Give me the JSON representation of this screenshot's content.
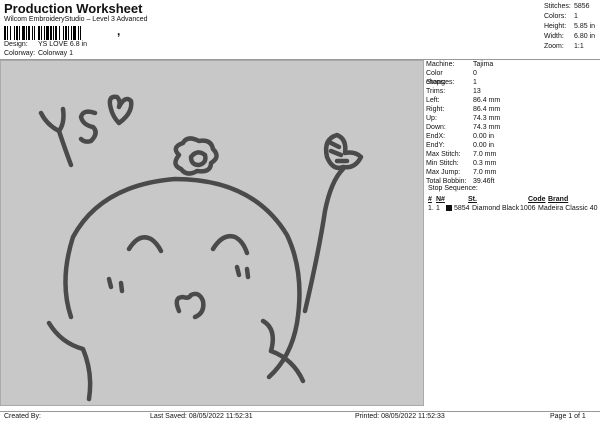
{
  "header": {
    "title": "Production Worksheet",
    "subtitle": "Wilcom EmbroideryStudio – Level 3 Advanced"
  },
  "design_info": [
    {
      "label": "Design:",
      "value": "YS LOVE 6.8 in"
    },
    {
      "label": "Colorway:",
      "value": "Colorway 1"
    }
  ],
  "stats": [
    {
      "label": "Stitches:",
      "value": "5856"
    },
    {
      "label": "Colors:",
      "value": "1"
    },
    {
      "label": "Height:",
      "value": "5.85 in"
    },
    {
      "label": "Width:",
      "value": "6.80 in"
    },
    {
      "label": "Zoom:",
      "value": "1:1"
    }
  ],
  "machine_info": [
    {
      "label": "Machine:",
      "value": "Tajima"
    },
    {
      "label": "Color changes:",
      "value": "0"
    },
    {
      "label": "Stops:",
      "value": "1"
    },
    {
      "label": "Trims:",
      "value": "13"
    },
    {
      "label": "Left:",
      "value": "86.4 mm"
    },
    {
      "label": "Right:",
      "value": "86.4 mm"
    },
    {
      "label": "Up:",
      "value": "74.3 mm"
    },
    {
      "label": "Down:",
      "value": "74.3 mm"
    },
    {
      "label": "EndX:",
      "value": "0.00 in"
    },
    {
      "label": "EndY:",
      "value": "0.00 in"
    },
    {
      "label": "Max Stitch:",
      "value": "7.0 mm"
    },
    {
      "label": "Min Stitch:",
      "value": "0.3 mm"
    },
    {
      "label": "Max Jump:",
      "value": "7.0 mm"
    },
    {
      "label": "Total Bobbin:",
      "value": "39.46ft"
    }
  ],
  "stop_sequence": {
    "title": "Stop Sequence:",
    "headers": [
      "#",
      "N#",
      "St.",
      "Code",
      "Brand"
    ],
    "rows": [
      {
        "num": "1.",
        "n": "1",
        "stitches": "5854",
        "color_name": "Diamond Black",
        "code": "1006",
        "brand": "Madeira Classic 40",
        "swatch": "#111111"
      }
    ]
  },
  "footer": {
    "created_by": "Created By:",
    "last_saved": "Last Saved: 08/05/2022 11:52:31",
    "printed": "Printed: 08/05/2022 11:52:33",
    "page": "Page 1 of 1"
  },
  "colors": {
    "thread": "#4a4a4a",
    "background": "#c8c8c8"
  }
}
